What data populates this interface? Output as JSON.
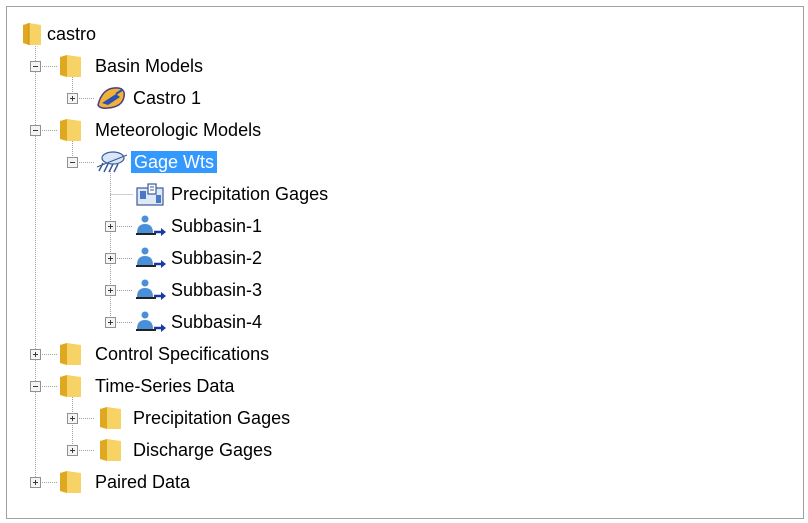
{
  "tree": {
    "root": {
      "label": "castro",
      "icon": "folder-icon"
    },
    "basin_models": {
      "label": "Basin Models",
      "icon": "folder-icon",
      "expanded": true
    },
    "castro_1": {
      "label": "Castro 1",
      "icon": "basin-model-icon",
      "expanded": false
    },
    "met_models": {
      "label": "Meteorologic Models",
      "icon": "folder-icon",
      "expanded": true
    },
    "gage_wts": {
      "label": "Gage Wts",
      "icon": "meteorologic-model-icon",
      "expanded": true,
      "selected": true
    },
    "precip_gages_node": {
      "label": "Precipitation Gages",
      "icon": "precipitation-gages-icon"
    },
    "subbasins": [
      {
        "label": "Subbasin-1",
        "icon": "subbasin-icon",
        "expanded": false
      },
      {
        "label": "Subbasin-2",
        "icon": "subbasin-icon",
        "expanded": false
      },
      {
        "label": "Subbasin-3",
        "icon": "subbasin-icon",
        "expanded": false
      },
      {
        "label": "Subbasin-4",
        "icon": "subbasin-icon",
        "expanded": false
      }
    ],
    "control_specs": {
      "label": "Control Specifications",
      "icon": "folder-icon",
      "expanded": false
    },
    "time_series": {
      "label": "Time-Series Data",
      "icon": "folder-icon",
      "expanded": true
    },
    "ts_precip": {
      "label": "Precipitation Gages",
      "icon": "folder-icon",
      "expanded": false
    },
    "ts_discharge": {
      "label": "Discharge Gages",
      "icon": "folder-icon",
      "expanded": false
    },
    "paired_data": {
      "label": "Paired Data",
      "icon": "folder-icon",
      "expanded": false
    }
  },
  "colors": {
    "selection": "#3399ff",
    "folder": "#f2c94c",
    "tree_line": "#a0a0a0"
  }
}
